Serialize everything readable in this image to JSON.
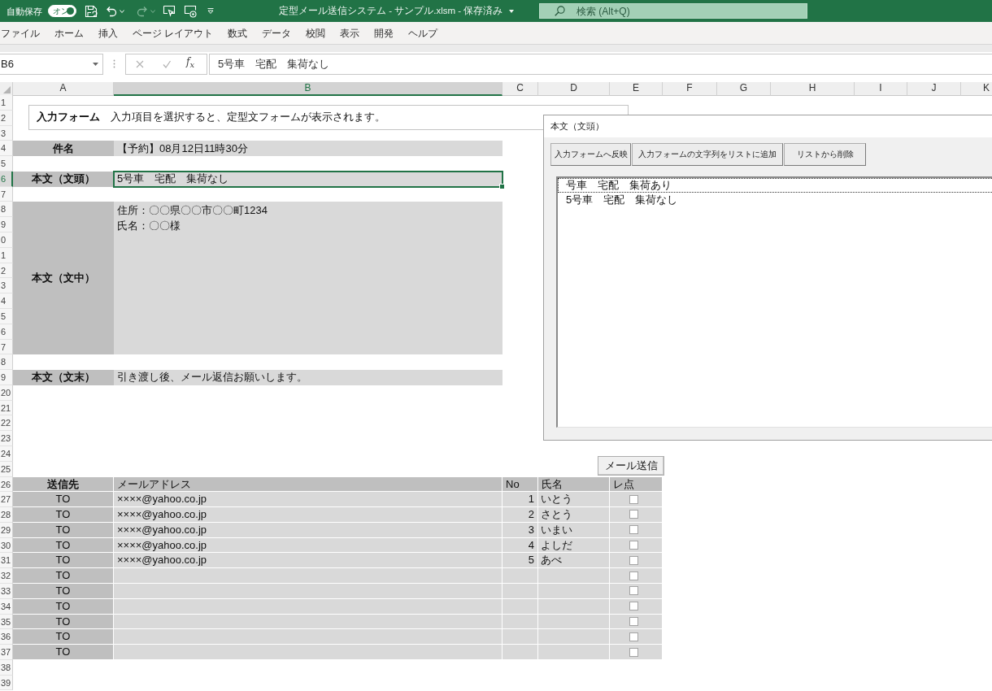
{
  "title_bar": {
    "autosave": {
      "label": "自動保存",
      "toggle_text": "オン",
      "on": true
    },
    "quick_access": [
      {
        "kind": "save",
        "disabled": false
      },
      {
        "kind": "undo",
        "disabled": false
      },
      {
        "kind": "redo",
        "disabled": true
      },
      {
        "kind": "screen_pointer",
        "disabled": false
      },
      {
        "kind": "screen_circle",
        "disabled": false
      },
      {
        "kind": "customize",
        "disabled": false
      }
    ],
    "title": "定型メール送信システム - サンプル.xlsm - 保存済み",
    "search": {
      "placeholder": "検索 (Alt+Q)"
    }
  },
  "ribbon_tabs": [
    "ファイル",
    "ホーム",
    "挿入",
    "ページ レイアウト",
    "数式",
    "データ",
    "校閲",
    "表示",
    "開発",
    "ヘルプ"
  ],
  "formula_bar": {
    "name_box": "B6",
    "buttons": [
      {
        "kind": "cancel",
        "disabled": true
      },
      {
        "kind": "enter",
        "disabled": true
      },
      {
        "kind": "function",
        "label": "f$_{x}$",
        "disabled": false
      }
    ],
    "formula": "5号車　宅配　集荷なし"
  },
  "sheet": {
    "columns": [
      {
        "label": "A",
        "selected": false
      },
      {
        "label": "B",
        "selected": true
      },
      {
        "label": "C",
        "selected": false
      },
      {
        "label": "D",
        "selected": false
      },
      {
        "label": "E",
        "selected": false
      },
      {
        "label": "F",
        "selected": false
      },
      {
        "label": "G",
        "selected": false
      },
      {
        "label": "H",
        "selected": false
      },
      {
        "label": "I",
        "selected": false
      },
      {
        "label": "J",
        "selected": false
      },
      {
        "label": "K",
        "selected": false
      }
    ],
    "rows": [
      {
        "label": "1",
        "selected": false
      },
      {
        "label": "2",
        "selected": false
      },
      {
        "label": "3",
        "selected": false
      },
      {
        "label": "4",
        "selected": false
      },
      {
        "label": "5",
        "selected": false
      },
      {
        "label": "6",
        "selected": true
      },
      {
        "label": "7",
        "selected": false
      },
      {
        "label": "8",
        "selected": false
      },
      {
        "label": "9",
        "selected": false
      },
      {
        "label": "0",
        "selected": false
      },
      {
        "label": "1",
        "selected": false
      },
      {
        "label": "2",
        "selected": false
      },
      {
        "label": "3",
        "selected": false
      },
      {
        "label": "4",
        "selected": false
      },
      {
        "label": "5",
        "selected": false
      },
      {
        "label": "6",
        "selected": false
      },
      {
        "label": "7",
        "selected": false
      },
      {
        "label": "8",
        "selected": false
      },
      {
        "label": "9",
        "selected": false
      },
      {
        "label": "20",
        "selected": false
      },
      {
        "label": "21",
        "selected": false
      },
      {
        "label": "22",
        "selected": false
      },
      {
        "label": "23",
        "selected": false
      },
      {
        "label": "24",
        "selected": false
      },
      {
        "label": "25",
        "selected": false
      },
      {
        "label": "26",
        "selected": false
      },
      {
        "label": "27",
        "selected": false
      },
      {
        "label": "28",
        "selected": false
      },
      {
        "label": "29",
        "selected": false
      },
      {
        "label": "30",
        "selected": false
      },
      {
        "label": "31",
        "selected": false
      },
      {
        "label": "32",
        "selected": false
      },
      {
        "label": "33",
        "selected": false
      },
      {
        "label": "34",
        "selected": false
      },
      {
        "label": "35",
        "selected": false
      },
      {
        "label": "36",
        "selected": false
      },
      {
        "label": "37",
        "selected": false
      },
      {
        "label": "38",
        "selected": false
      },
      {
        "label": "39",
        "selected": false
      }
    ],
    "instruction": "**入力フォーム**　入力項目を選択すると、定型文フォームが表示されます。",
    "form_rows": [
      {
        "kind": "single",
        "label": "件名",
        "value": "【予約】08月12日11時30分",
        "selected": false
      },
      {
        "kind": "single",
        "label": "本文（文頭）",
        "value": "5号車　宅配　集荷なし",
        "selected": true
      },
      {
        "kind": "multi",
        "label": "本文（文中）",
        "lines": [
          "住所：〇〇県〇〇市〇〇町1234",
          "氏名：〇〇様"
        ],
        "selected": false
      },
      {
        "kind": "single",
        "label": "本文（文末）",
        "value": "引き渡し後、メール返信お願いします。",
        "selected": false
      }
    ],
    "send_button": "メール送信",
    "recipients": {
      "header": [
        "送信先",
        "メールアドレス",
        "No",
        "氏名",
        "レ点"
      ],
      "rows": [
        {
          "type": "TO",
          "email": "××××@yahoo.co.jp",
          "no": "1",
          "name": "いとう",
          "checked": false
        },
        {
          "type": "TO",
          "email": "××××@yahoo.co.jp",
          "no": "2",
          "name": "さとう",
          "checked": false
        },
        {
          "type": "TO",
          "email": "××××@yahoo.co.jp",
          "no": "3",
          "name": "いまい",
          "checked": false
        },
        {
          "type": "TO",
          "email": "××××@yahoo.co.jp",
          "no": "4",
          "name": "よしだ",
          "checked": false
        },
        {
          "type": "TO",
          "email": "××××@yahoo.co.jp",
          "no": "5",
          "name": "あべ",
          "checked": false
        },
        {
          "type": "TO",
          "checked": false
        },
        {
          "type": "TO",
          "checked": false
        },
        {
          "type": "TO",
          "checked": false
        },
        {
          "type": "TO",
          "checked": false
        },
        {
          "type": "TO",
          "checked": false
        },
        {
          "type": "TO",
          "checked": false
        }
      ]
    }
  },
  "dialog": {
    "title": "本文（文頭）",
    "buttons": [
      "入力フォームへ反映",
      "入力フォームの文字列をリストに追加",
      "リストから削除"
    ],
    "list_items": [
      {
        "text": "号車　宅配　集荷あり",
        "focused": true
      },
      {
        "text": "5号車　宅配　集荷なし",
        "focused": false
      }
    ]
  }
}
